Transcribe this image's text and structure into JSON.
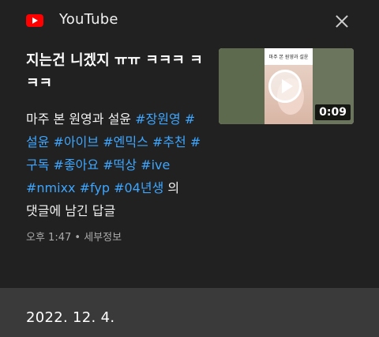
{
  "header": {
    "app_name": "YouTube",
    "logo_icon": "youtube-logo-icon",
    "close_icon": "close-icon"
  },
  "notification": {
    "title": "지는건 니겠지 ㅠㅠ ㅋㅋㅋ ㅋㅋㅋ",
    "body_prefix": "마주 본 원영과 설윤",
    "tags": [
      "#장원영",
      "#설윤",
      "#아이브",
      "#엔믹스",
      "#추천",
      "#구독",
      "#좋아요",
      "#떡상",
      "#ive",
      "#nmixx",
      "#fyp",
      "#04년생"
    ],
    "body_suffix": "의 댓글에 남긴 답글",
    "time": "오후 1:47",
    "separator": "•",
    "detail_link": "세부정보",
    "thumbnail": {
      "caption": "마주 본 원영과 설윤",
      "duration": "0:09",
      "play_icon": "play-icon"
    }
  },
  "date_header": "2022. 12. 4.",
  "colors": {
    "background": "#212121",
    "hashtag": "#3ea6ff",
    "date_bar": "#3a3a3a",
    "brand_red": "#ff0000"
  }
}
